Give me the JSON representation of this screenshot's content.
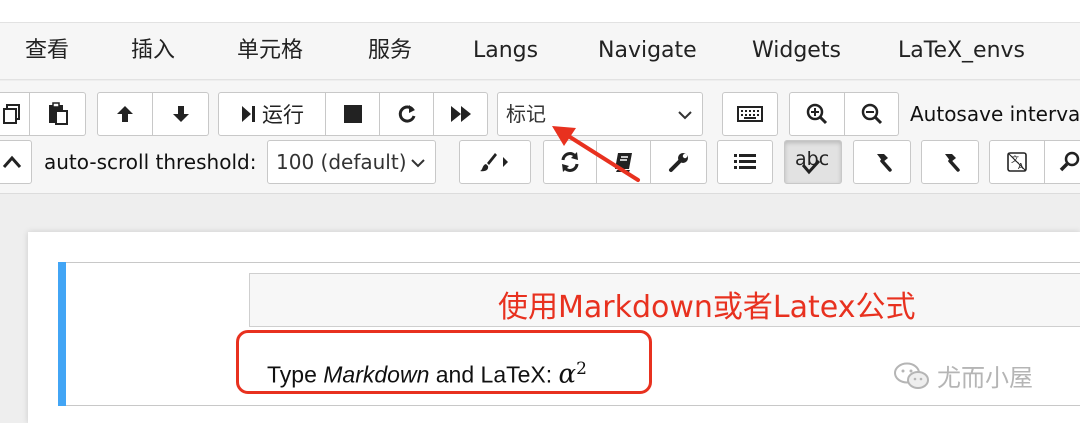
{
  "menubar": {
    "items": [
      "查看",
      "插入",
      "单元格",
      "服务",
      "Langs",
      "Navigate",
      "Widgets",
      "LaTeX_envs"
    ]
  },
  "toolbar": {
    "run_label": "运行",
    "cell_type_select": {
      "selected": "标记"
    },
    "autosave_label": "Autosave interva",
    "autoscroll_label": "auto-scroll threshold:",
    "autoscroll_select": {
      "selected": "100 (default)"
    },
    "spellcheck_label": "abc"
  },
  "cell": {
    "annotation": "使用Markdown或者Latex公式",
    "rendered": {
      "prefix": "Type ",
      "emphasis": "Markdown",
      "middle": " and LaTeX: ",
      "math_base": "α",
      "math_sup": "2"
    }
  },
  "watermark": {
    "text": "尤而小屋"
  },
  "colors": {
    "accent_red": "#e8311f",
    "cell_bar_blue": "#42a5f5",
    "toolbar_bg": "#f6f6f6"
  }
}
